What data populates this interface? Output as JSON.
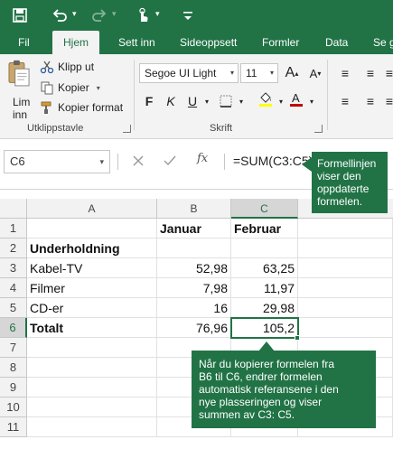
{
  "ribbon_tabs": [
    "Fil",
    "Hjem",
    "Sett inn",
    "Sideoppsett",
    "Formler",
    "Data",
    "Se gj"
  ],
  "clipboard": {
    "paste_label_line1": "Lim",
    "paste_label_line2": "inn",
    "cut": "Klipp ut",
    "copy": "Kopier",
    "format_painter": "Kopier format",
    "group_label": "Utklippstavle"
  },
  "font": {
    "name": "Segoe UI Light",
    "size": "11",
    "bold": "F",
    "italic": "K",
    "underline": "U",
    "group_label": "Skrift"
  },
  "formula_bar": {
    "name_box": "C6",
    "fx": "fx",
    "formula": "=SUM(C3:C5)"
  },
  "columns": [
    "A",
    "B",
    "C"
  ],
  "rows": [
    "1",
    "2",
    "3",
    "4",
    "5",
    "6",
    "7",
    "8",
    "9",
    "10",
    "11"
  ],
  "cells": {
    "B1": "Januar",
    "C1": "Februar",
    "A2": "Underholdning",
    "A3": "Kabel-TV",
    "B3": "52,98",
    "C3": "63,25",
    "A4": "Filmer",
    "B4": "7,98",
    "C4": "11,97",
    "A5": "CD-er",
    "B5": "16",
    "C5": "29,98",
    "A6": "Totalt",
    "B6": "76,96",
    "C6": "105,2"
  },
  "selected_cell": "C6",
  "callouts": {
    "formula_bar_note": "Formellinjen\nviser den\noppdaterte\nformelen.",
    "copy_note": "Når du kopierer formelen fra\nB6 til C6, endrer formelen\nautomatisk referansene i den\nnye plasseringen og viser\nsummen av C3: C5."
  },
  "colors": {
    "accent": "#217346",
    "ribbon_bg": "#f3f3f3",
    "header_bg": "#f2f2f2"
  }
}
